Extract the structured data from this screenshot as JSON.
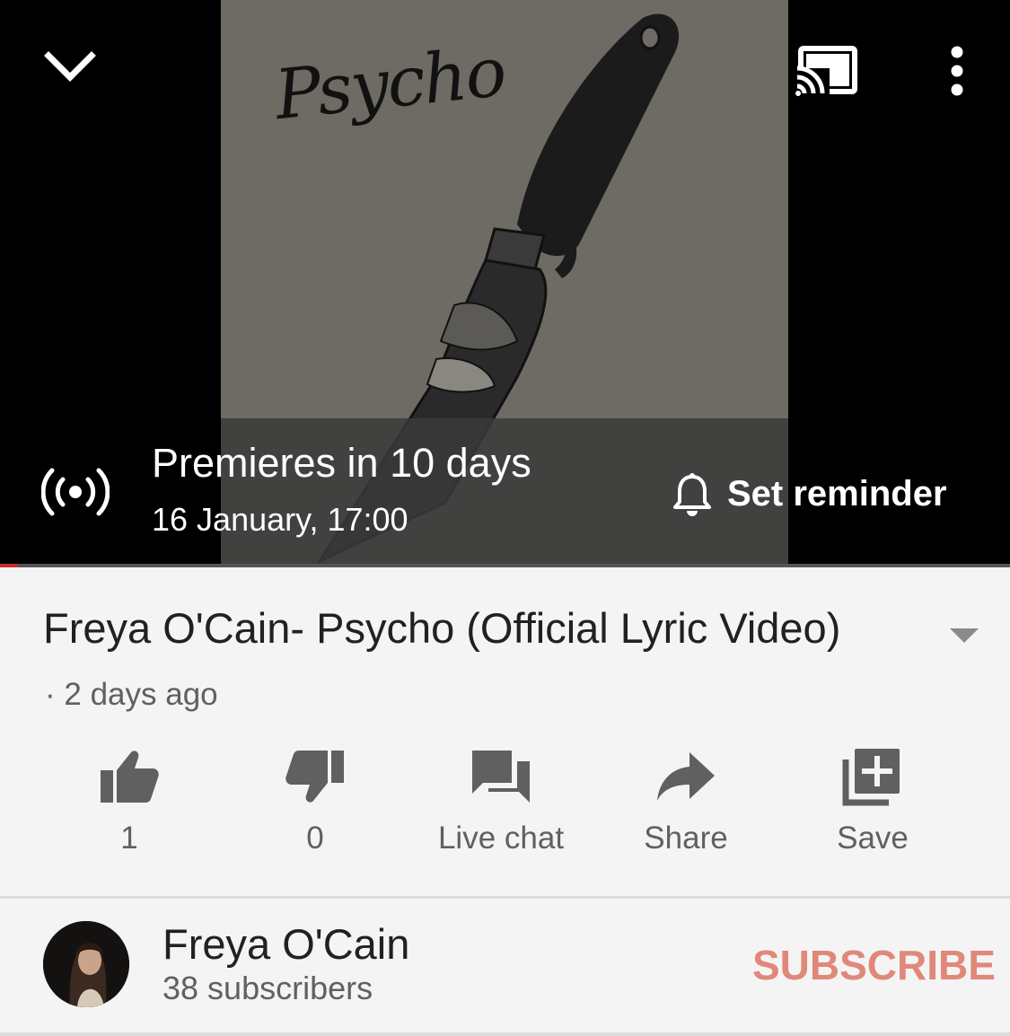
{
  "player": {
    "thumbnail_title": "Psycho",
    "premiere": {
      "title": "Premieres in 10 days",
      "datetime": "16 January, 17:00",
      "reminder_label": "Set reminder"
    }
  },
  "video": {
    "title": "Freya O'Cain- Psycho (Official Lyric Video)",
    "meta": "· 2 days ago"
  },
  "actions": {
    "like_count": "1",
    "dislike_count": "0",
    "live_chat_label": "Live chat",
    "share_label": "Share",
    "save_label": "Save"
  },
  "channel": {
    "name": "Freya O'Cain",
    "subscribers": "38 subscribers",
    "subscribe_label": "SUBSCRIBE"
  },
  "colors": {
    "subscribe": "#e0887a",
    "text_primary": "#212121",
    "text_secondary": "#606060",
    "background": "#f4f4f4"
  }
}
